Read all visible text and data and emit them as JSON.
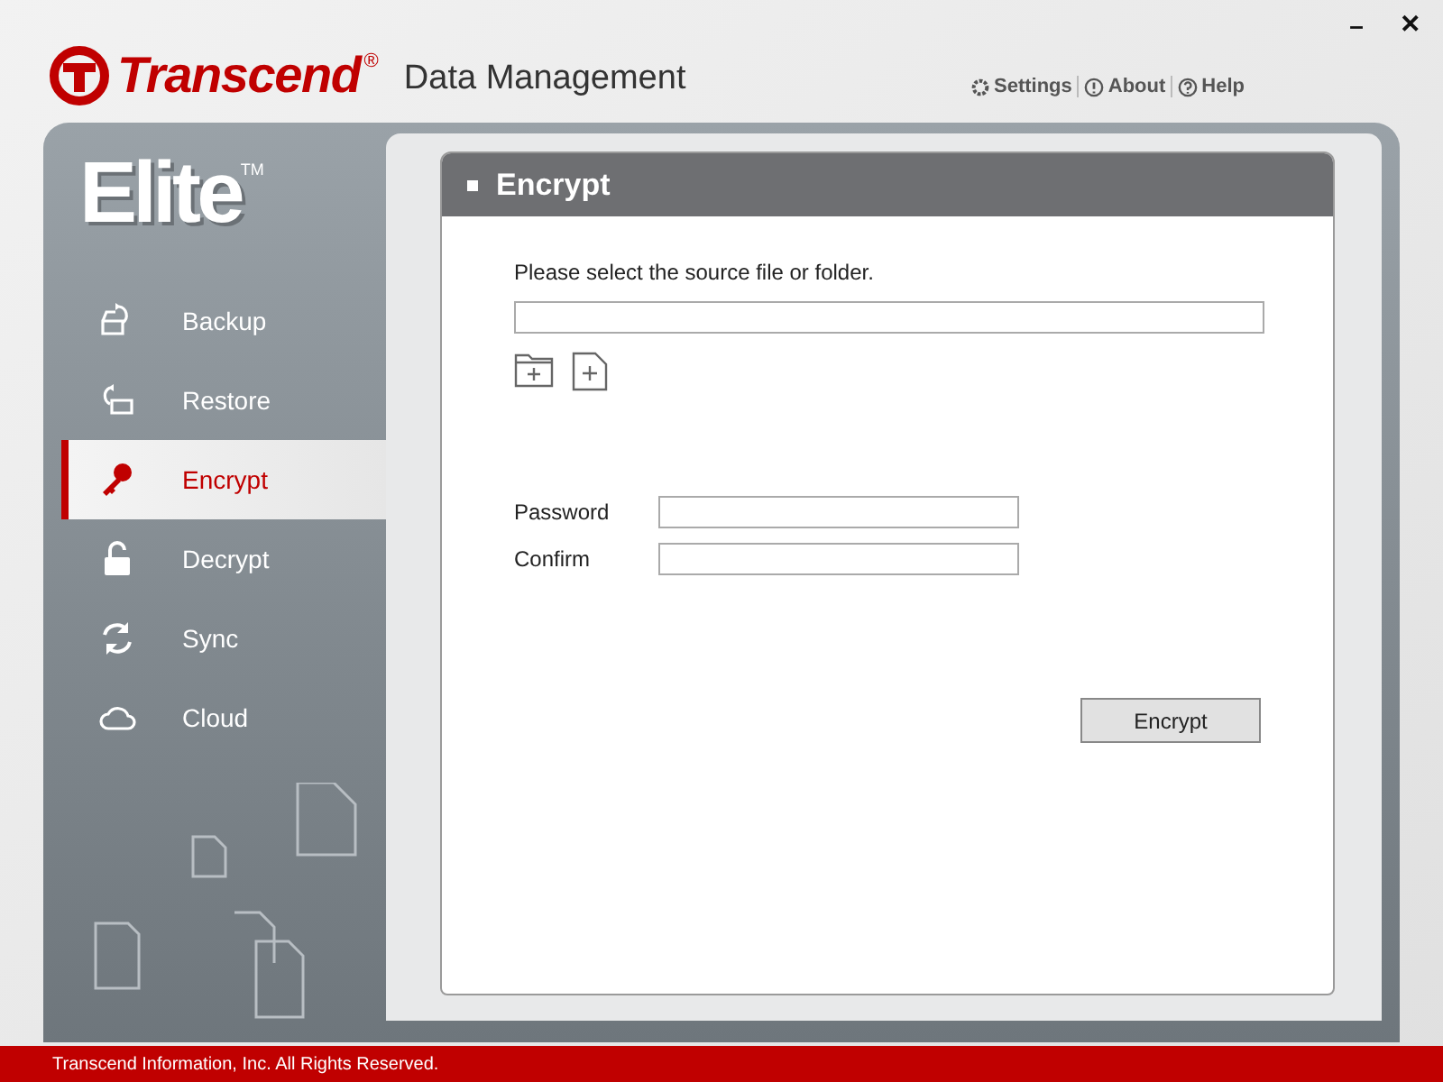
{
  "header": {
    "brand": "Transcend",
    "registered": "®",
    "app_title": "Data Management",
    "links": [
      {
        "kind": "settings",
        "label": "Settings"
      },
      {
        "kind": "about",
        "label": "About"
      },
      {
        "kind": "help",
        "label": "Help"
      }
    ],
    "window_buttons": [
      {
        "kind": "minimize",
        "label": "–"
      },
      {
        "kind": "close",
        "label": "✕"
      }
    ]
  },
  "sidebar": {
    "logo": "Elite",
    "trademark": "TM",
    "items": [
      {
        "kind": "backup",
        "label": "Backup",
        "selected": false
      },
      {
        "kind": "restore",
        "label": "Restore",
        "selected": false
      },
      {
        "kind": "encrypt",
        "label": "Encrypt",
        "selected": true
      },
      {
        "kind": "decrypt",
        "label": "Decrypt",
        "selected": false
      },
      {
        "kind": "sync",
        "label": "Sync",
        "selected": false
      },
      {
        "kind": "cloud",
        "label": "Cloud",
        "selected": false
      }
    ]
  },
  "panel": {
    "title": "Encrypt",
    "source_label": "Please select the source file or folder.",
    "fields": [
      {
        "label": "Password"
      },
      {
        "label": "Confirm"
      }
    ],
    "button": "Encrypt"
  },
  "footer": "Transcend Information, Inc. All Rights Reserved."
}
